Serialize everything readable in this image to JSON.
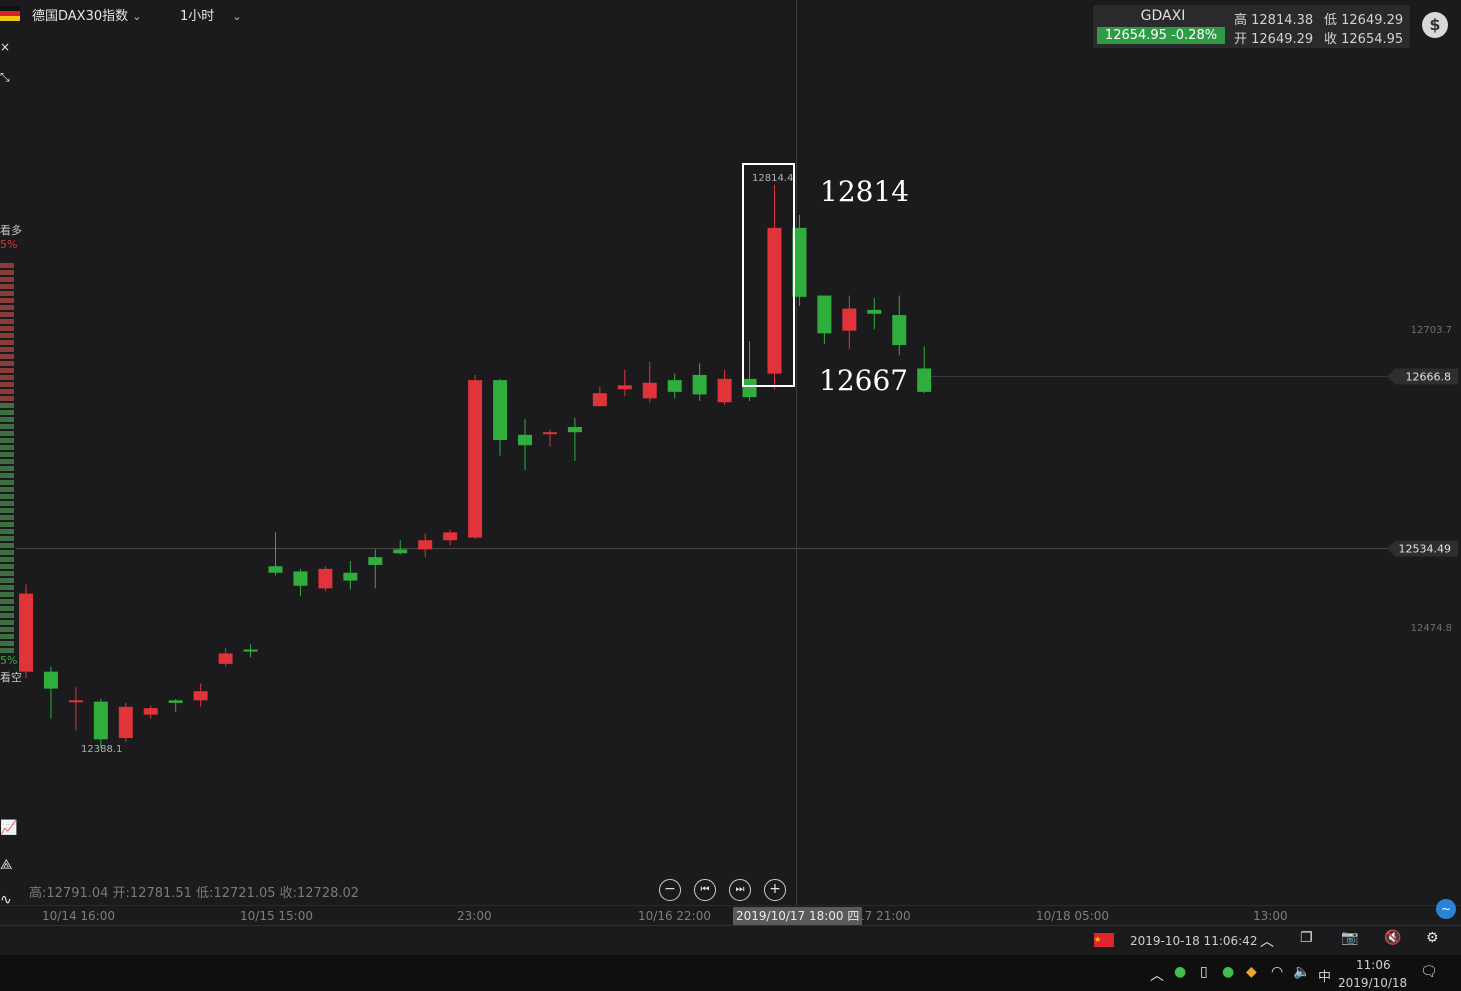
{
  "header": {
    "instrument": "德国DAX30指数",
    "interval": "1小时"
  },
  "quote": {
    "symbol": "GDAXI",
    "price_change": "12654.95  -0.28%",
    "high": "高 12814.38",
    "low": "低 12649.29",
    "open": "开 12649.29",
    "close": "收 12654.95"
  },
  "left_panel": {
    "long_label": "看多",
    "long_pct": "5%",
    "short_pct": "5%",
    "short_label": "看空"
  },
  "ohlc_readout": "高:12791.04 开:12781.51 低:12721.05 收:12728.02",
  "cursor_time_label": "2019/10/17 18:00 四",
  "status": {
    "datetime": "2019-10-18 11:06:42"
  },
  "taskbar": {
    "ime": "中",
    "time": "11:06",
    "date": "2019/10/18"
  },
  "colors": {
    "up": "#e0343a",
    "down": "#2fae3d",
    "background": "#1b1b1d"
  },
  "chart_data": {
    "type": "candlestick",
    "x_tick_labels": [
      "10/14 16:00",
      "10/15 15:00",
      "23:00",
      "10/16 22:00",
      "17 21:00",
      "10/18 05:00",
      "13:00"
    ],
    "y_tick_labels": [
      "12703.7",
      "12474.8"
    ],
    "price_markers": [
      "12666.8",
      "12534.49"
    ],
    "data_labels": [
      "12814.4",
      "12388.1"
    ],
    "annotations": [
      "12814",
      "12667"
    ],
    "candles": [
      {
        "o": 12440,
        "c": 12500,
        "h": 12507,
        "l": 12435
      },
      {
        "o": 12440,
        "c": 12427,
        "h": 12444,
        "l": 12404
      },
      {
        "o": 12418,
        "c": 12418,
        "h": 12428,
        "l": 12395
      },
      {
        "o": 12417,
        "c": 12388,
        "h": 12419,
        "l": 12381
      },
      {
        "o": 12389,
        "c": 12413,
        "h": 12416,
        "l": 12386
      },
      {
        "o": 12407,
        "c": 12412,
        "h": 12414,
        "l": 12404
      },
      {
        "o": 12418,
        "c": 12416,
        "h": 12419,
        "l": 12409
      },
      {
        "o": 12418,
        "c": 12425,
        "h": 12431,
        "l": 12413
      },
      {
        "o": 12446,
        "c": 12454,
        "h": 12458,
        "l": 12444
      },
      {
        "o": 12457,
        "c": 12456,
        "h": 12461,
        "l": 12451
      },
      {
        "o": 12521,
        "c": 12516,
        "h": 12547,
        "l": 12514
      },
      {
        "o": 12517,
        "c": 12506,
        "h": 12519,
        "l": 12498
      },
      {
        "o": 12504,
        "c": 12519,
        "h": 12521,
        "l": 12502
      },
      {
        "o": 12516,
        "c": 12510,
        "h": 12525,
        "l": 12503
      },
      {
        "o": 12528,
        "c": 12522,
        "h": 12534,
        "l": 12504
      },
      {
        "o": 12534,
        "c": 12531,
        "h": 12541,
        "l": 12530
      },
      {
        "o": 12534,
        "c": 12541,
        "h": 12546,
        "l": 12528
      },
      {
        "o": 12541,
        "c": 12547,
        "h": 12549,
        "l": 12537
      },
      {
        "o": 12543,
        "c": 12664,
        "h": 12668,
        "l": 12542
      },
      {
        "o": 12664,
        "c": 12618,
        "h": 12665,
        "l": 12606
      },
      {
        "o": 12622,
        "c": 12614,
        "h": 12634,
        "l": 12595
      },
      {
        "o": 12624,
        "c": 12624,
        "h": 12626,
        "l": 12613
      },
      {
        "o": 12628,
        "c": 12624,
        "h": 12635,
        "l": 12602
      },
      {
        "o": 12644,
        "c": 12654,
        "h": 12659,
        "l": 12644
      },
      {
        "o": 12657,
        "c": 12660,
        "h": 12672,
        "l": 12652
      },
      {
        "o": 12650,
        "c": 12662,
        "h": 12678,
        "l": 12647
      },
      {
        "o": 12664,
        "c": 12655,
        "h": 12669,
        "l": 12650
      },
      {
        "o": 12668,
        "c": 12653,
        "h": 12677,
        "l": 12648
      },
      {
        "o": 12647,
        "c": 12665,
        "h": 12672,
        "l": 12645
      },
      {
        "o": 12665,
        "c": 12651,
        "h": 12694,
        "l": 12648
      },
      {
        "o": 12669,
        "c": 12781,
        "h": 12814,
        "l": 12657
      },
      {
        "o": 12781,
        "c": 12728,
        "h": 12791,
        "l": 12721
      },
      {
        "o": 12729,
        "c": 12700,
        "h": 12729,
        "l": 12692
      },
      {
        "o": 12702,
        "c": 12719,
        "h": 12729,
        "l": 12688
      },
      {
        "o": 12718,
        "c": 12715,
        "h": 12727,
        "l": 12703
      },
      {
        "o": 12714,
        "c": 12691,
        "h": 12729,
        "l": 12683
      },
      {
        "o": 12673,
        "c": 12655,
        "h": 12690,
        "l": 12654
      }
    ]
  }
}
